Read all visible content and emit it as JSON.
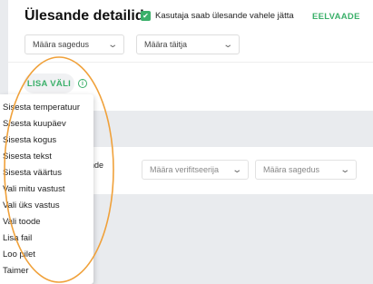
{
  "header": {
    "title": "Ülesande detailid",
    "skip_checkbox_label": "Kasutaja saab ülesande vahele jätta",
    "skip_checkbox_checked": true,
    "preview_label": "EELVAADE"
  },
  "top_selects": {
    "frequency": "Määra sagedus",
    "assignee": "Määra täitja"
  },
  "add_field": {
    "button_label": "LISA VÄLI",
    "info_icon": "info-icon"
  },
  "lower_row": {
    "partial_label": "nde",
    "verifier": "Määra verifitseerija",
    "frequency": "Määra sagedus"
  },
  "dropdown_menu": {
    "items": [
      "Sisesta temperatuur",
      "Sisesta kuupäev",
      "Sisesta kogus",
      "Sisesta tekst",
      "Sisesta väärtus",
      "Vali mitu vastust",
      "Vali üks vastus",
      "Vali toode",
      "Lisa fail",
      "Loo pilet",
      "Taimer"
    ]
  },
  "colors": {
    "accent": "#3bb06a",
    "annotation": "#f0a13a",
    "background": "#e9ebee"
  }
}
